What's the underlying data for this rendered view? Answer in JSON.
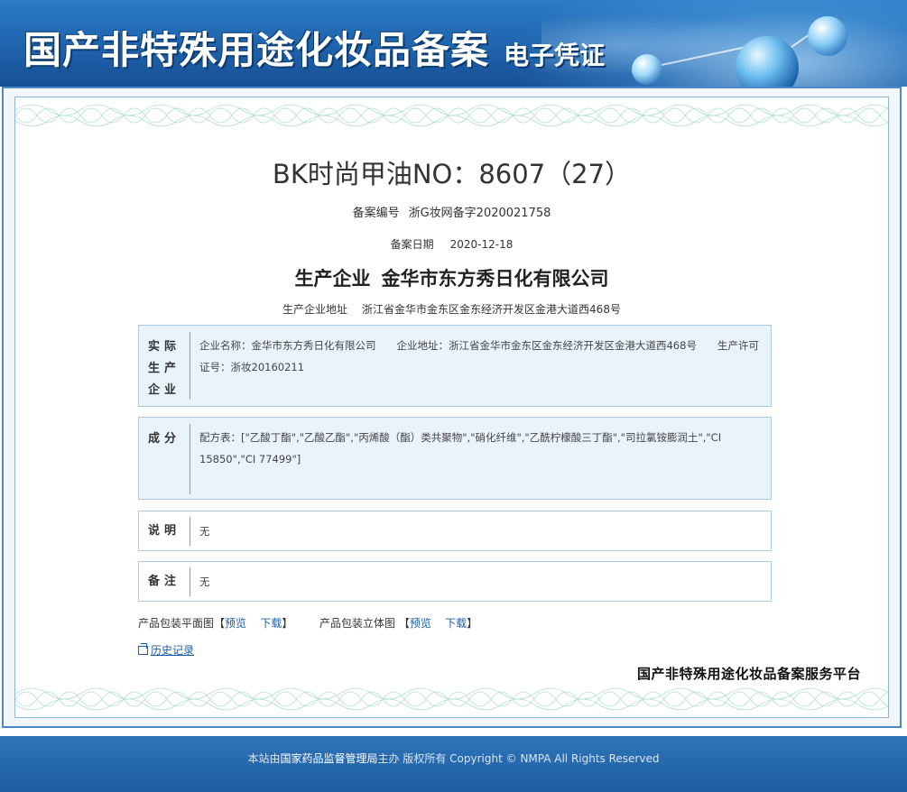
{
  "header": {
    "title": "国产非特殊用途化妆品备案",
    "subtitle": "电子凭证"
  },
  "record": {
    "product_name": "BK时尚甲油NO：8607（27）",
    "reg_no_label": "备案编号",
    "reg_no_value": "浙G妆网备字2020021758",
    "reg_date_label": "备案日期",
    "reg_date_value": "2020-12-18",
    "maker_label": "生产企业",
    "maker_value": "金华市东方秀日化有限公司",
    "maker_addr_label": "生产企业地址",
    "maker_addr_value": "浙江省金华市金东区金东经济开发区金港大道西468号"
  },
  "sections": {
    "actual_maker": {
      "label": "实际生产企业",
      "content": "企业名称：金华市东方秀日化有限公司　　企业地址：浙江省金华市金东区金东经济开发区金港大道西468号　　生产许可证号：浙妆20160211"
    },
    "ingredients": {
      "label": "成分",
      "content": "配方表：[\"乙酸丁酯\",\"乙酸乙酯\",\"丙烯酸（酯）类共聚物\",\"硝化纤维\",\"乙酰柠檬酸三丁酯\",\"司拉氯铵膨润土\",\"CI 15850\",\"CI 77499\"]"
    },
    "description": {
      "label": "说明",
      "content": "无"
    },
    "remarks": {
      "label": "备注",
      "content": "无"
    }
  },
  "packaging": {
    "flat_label": "产品包装平面图",
    "solid_label": "产品包装立体图",
    "bracket_open": "【",
    "bracket_close": "】",
    "preview": "预览",
    "download": "下载"
  },
  "history_link": "历史记录",
  "platform_name": "国产非特殊用途化妆品备案服务平台",
  "footer": {
    "prefix": "本站由",
    "org": "国家药品监督管理局",
    "suffix": "主办 版权所有 Copyright © NMPA All Rights Reserved"
  },
  "colors": {
    "banner": "#1f63ad",
    "link": "#1a5ea8",
    "box_fill": "#e9f3fb",
    "box_border": "#a8c8e4"
  }
}
